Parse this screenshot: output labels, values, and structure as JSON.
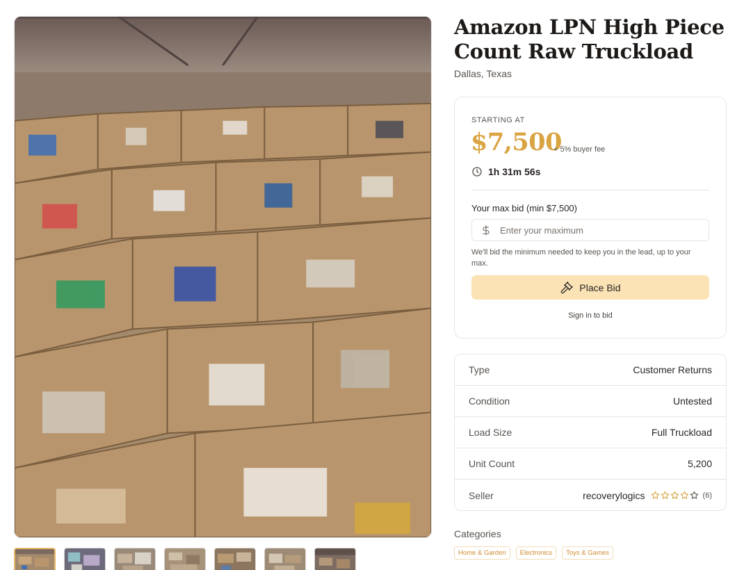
{
  "listing": {
    "title": "Amazon LPN High Piece Count Raw Truckload",
    "location": "Dallas, Texas"
  },
  "gallery": {
    "main_image": "photo of warehouse full of open cardboard gaylord boxes filled with mixed merchandise",
    "thumbnail_count": 7,
    "active_thumbnail": 1
  },
  "bid": {
    "starting_label": "STARTING AT",
    "price": "$7,500",
    "fee": "+ 5% buyer fee",
    "time_left": "1h 31m 56s",
    "max_bid_label": "Your max bid (min $7,500)",
    "input_placeholder": "Enter your maximum",
    "input_value": "",
    "help_text": "We'll bid the minimum needed to keep you in the lead, up to your max.",
    "button_label": "Place Bid",
    "signin_label": "Sign in to bid"
  },
  "details": {
    "rows": [
      {
        "label": "Type",
        "value": "Customer Returns"
      },
      {
        "label": "Condition",
        "value": "Untested"
      },
      {
        "label": "Load Size",
        "value": "Full Truckload"
      },
      {
        "label": "Unit Count",
        "value": "5,200"
      }
    ],
    "seller": {
      "label": "Seller",
      "name": "recoverylogics",
      "rating_count": "(6)",
      "stars_filled": 4,
      "stars_total": 5
    }
  },
  "categories": {
    "title": "Categories",
    "items": [
      "Home & Garden",
      "Electronics",
      "Toys & Games"
    ]
  },
  "colors": {
    "accent": "#d9a441",
    "button_bg": "#fbe3b5",
    "chip_text": "#d08a2f",
    "border": "#e7e5e4"
  },
  "icons": {
    "timer": "clock-icon",
    "currency": "dollar-icon",
    "bid": "gavel-icon",
    "rating": "star-icon"
  }
}
